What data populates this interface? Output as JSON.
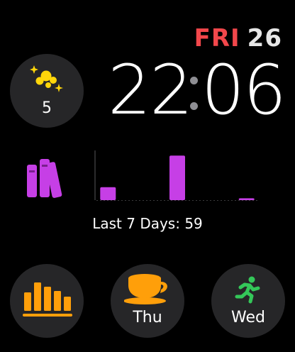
{
  "date": {
    "weekday": "FRI",
    "day": "26"
  },
  "time": {
    "hours": "22",
    "minutes": "06"
  },
  "top_complication": {
    "icon": "bubbles-icon",
    "value": "5",
    "color": "#ffd60a"
  },
  "activity": {
    "icon": "books-icon",
    "color": "#c63fe6",
    "caption": "Last 7 Days: 59",
    "chart_data": {
      "type": "bar",
      "values": [
        7,
        0,
        0,
        24,
        0,
        0,
        1
      ],
      "ylim": [
        0,
        26
      ]
    }
  },
  "bottom": [
    {
      "icon": "bar-chart-icon",
      "label": "",
      "color": "#ff9f0a"
    },
    {
      "icon": "coffee-cup-icon",
      "label": "Thu",
      "color": "#ff9f0a"
    },
    {
      "icon": "running-figure-icon",
      "label": "Wed",
      "color": "#34c759"
    }
  ]
}
